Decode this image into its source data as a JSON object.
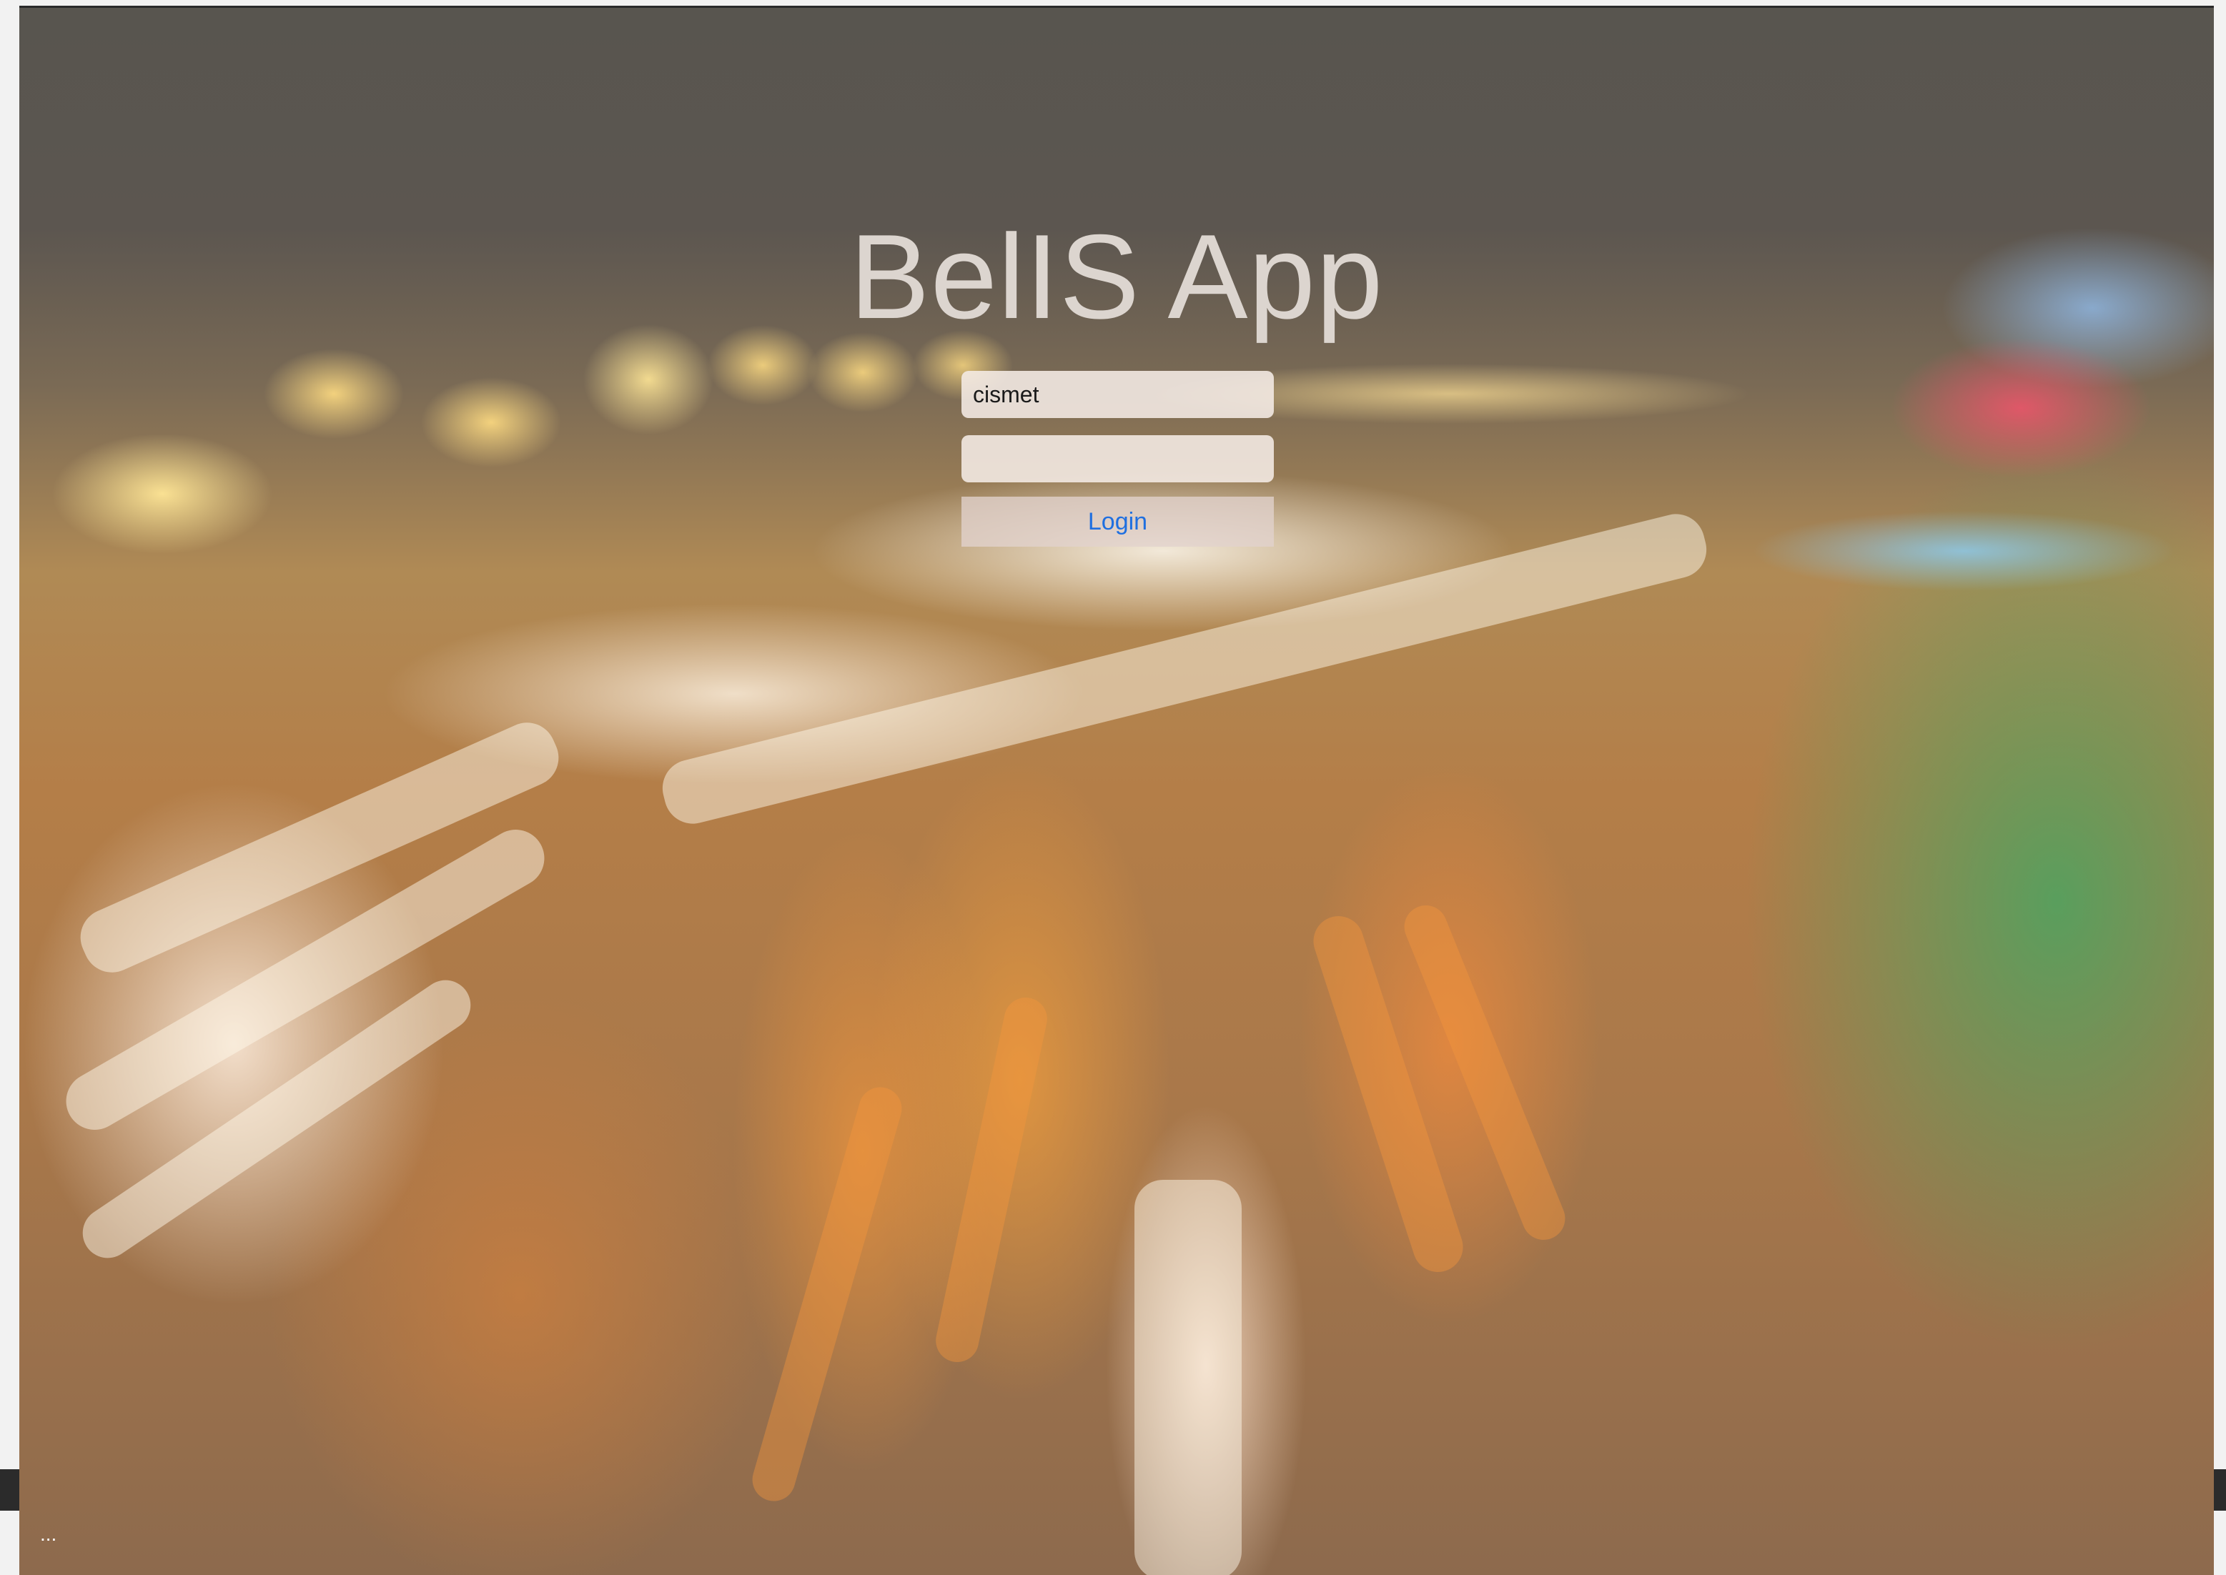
{
  "app": {
    "title": "BelIS App"
  },
  "login_form": {
    "username_value": "cismet",
    "password_value": "",
    "login_label": "Login"
  },
  "footer": {
    "ellipsis": "..."
  },
  "colors": {
    "title": "#dcd5cf",
    "login_text": "#1f6fe0",
    "field_bg": "#f5ece6"
  }
}
